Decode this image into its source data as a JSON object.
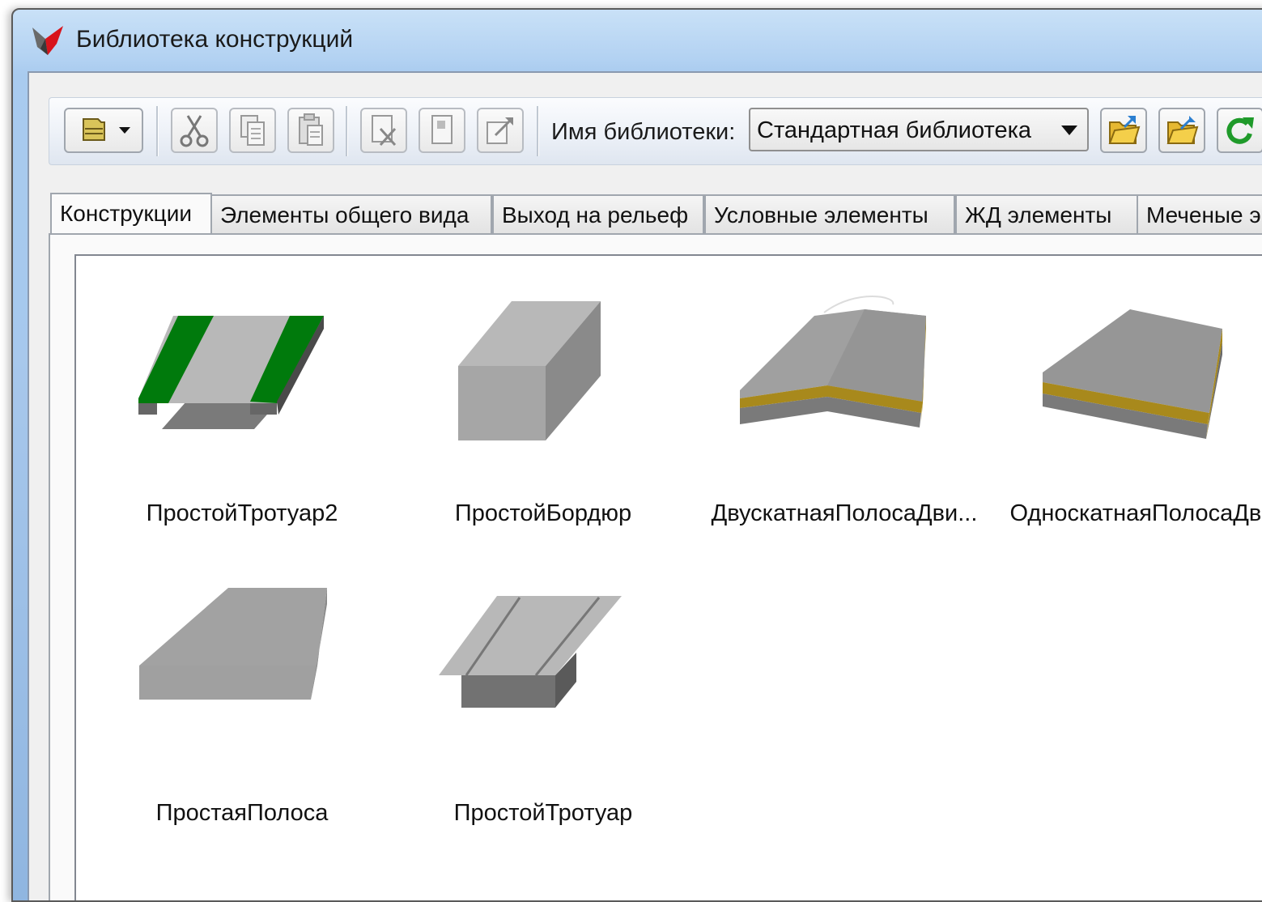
{
  "window": {
    "title": "Библиотека конструкций",
    "logo_icon": "app-logo-icon"
  },
  "toolbar": {
    "buttons": [
      {
        "name": "open-menu-button",
        "icon": "folder-icon",
        "enabled": true
      },
      {
        "name": "cut-button",
        "icon": "scissors-icon",
        "enabled": false
      },
      {
        "name": "copy-button",
        "icon": "copy-icon",
        "enabled": false
      },
      {
        "name": "paste-button",
        "icon": "paste-icon",
        "enabled": false
      },
      {
        "name": "delete-button",
        "icon": "delete-document-icon",
        "enabled": false
      },
      {
        "name": "properties-button",
        "icon": "document-icon",
        "enabled": false
      },
      {
        "name": "export-button",
        "icon": "export-document-icon",
        "enabled": false
      },
      {
        "name": "open-library-button",
        "icon": "open-folder-icon",
        "enabled": true
      },
      {
        "name": "save-library-button",
        "icon": "save-folder-icon",
        "enabled": true
      },
      {
        "name": "refresh-button",
        "icon": "refresh-icon",
        "enabled": true
      }
    ],
    "library_label": "Имя библиотеки:",
    "library_value": "Стандартная библиотека"
  },
  "tabs": [
    {
      "label": "Конструкции",
      "active": true
    },
    {
      "label": "Элементы общего вида",
      "active": false
    },
    {
      "label": "Выход на рельеф",
      "active": false
    },
    {
      "label": "Условные элементы",
      "active": false
    },
    {
      "label": "ЖД элементы",
      "active": false
    },
    {
      "label": "Меченые э",
      "active": false
    }
  ],
  "items": [
    {
      "label": "ПростойТротуар2",
      "icon": "sidewalk-green-icon"
    },
    {
      "label": "ПростойБордюр",
      "icon": "curb-block-icon"
    },
    {
      "label": "ДвускатнаяПолосаДви...",
      "icon": "double-slope-lane-icon"
    },
    {
      "label": "ОдноскатнаяПолосаДв...",
      "icon": "single-slope-lane-icon"
    },
    {
      "label": "ПростаяПолоса",
      "icon": "simple-lane-icon"
    },
    {
      "label": "ПростойТротуар",
      "icon": "sidewalk-icon"
    }
  ],
  "colors": {
    "green": "#007a0c",
    "yellow": "#a8891c",
    "gray_light": "#b8b8b8",
    "gray_mid": "#959595",
    "gray_dark": "#767676",
    "titlebar": "#b3d2f2"
  }
}
